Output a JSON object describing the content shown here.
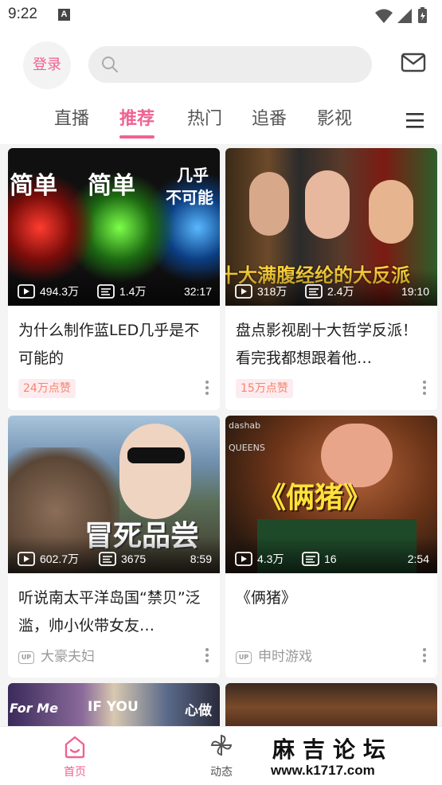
{
  "status_bar": {
    "time": "9:22",
    "notification": "A"
  },
  "header": {
    "login_label": "登录",
    "search_placeholder": "",
    "tabs": [
      {
        "label": "直播"
      },
      {
        "label": "推荐",
        "active": true
      },
      {
        "label": "热门"
      },
      {
        "label": "追番"
      },
      {
        "label": "影视"
      }
    ]
  },
  "icons": {
    "search": "search-icon",
    "mail": "mail-icon",
    "menu": "menu-icon",
    "play": "play-count-icon",
    "danmaku": "danmaku-count-icon",
    "more": "more-vertical-icon"
  },
  "colors": {
    "accent": "#f06292",
    "badge_text": "#f4866e",
    "badge_bg": "#fdecef"
  },
  "cards": [
    {
      "thumb_text": [
        "简单",
        "简单",
        "几乎",
        "不可能"
      ],
      "plays": "494.3万",
      "danmaku": "1.4万",
      "duration": "32:17",
      "title": "为什么制作蓝LED几乎是不可能的",
      "badge": "24万点赞"
    },
    {
      "thumb_text": [
        "十大满腹经纶的大反派"
      ],
      "plays": "318万",
      "danmaku": "2.4万",
      "duration": "19:10",
      "title": "盘点影视剧十大哲学反派！看完我都想跟着他…",
      "badge": "15万点赞"
    },
    {
      "thumb_text": [
        "冒死品尝"
      ],
      "plays": "602.7万",
      "danmaku": "3675",
      "duration": "8:59",
      "title": "听说南太平洋岛国“禁贝”泛滥，帅小伙带女友…",
      "up": "大豪夫妇"
    },
    {
      "thumb_text": [
        "《俩猪》",
        "dashab",
        "QUEENS"
      ],
      "plays": "4.3万",
      "danmaku": "16",
      "duration": "2:54",
      "title": "《俩猪》",
      "up": "申时游戏"
    },
    {
      "thumb_text": [
        "For Me",
        "IF YOU",
        "心做"
      ]
    },
    {
      "thumb_text": []
    }
  ],
  "bottom_nav": [
    {
      "label": "首页",
      "active": true
    },
    {
      "label": "动态"
    }
  ],
  "watermark": {
    "title": "麻吉论坛",
    "url": "www.k1717.com"
  }
}
